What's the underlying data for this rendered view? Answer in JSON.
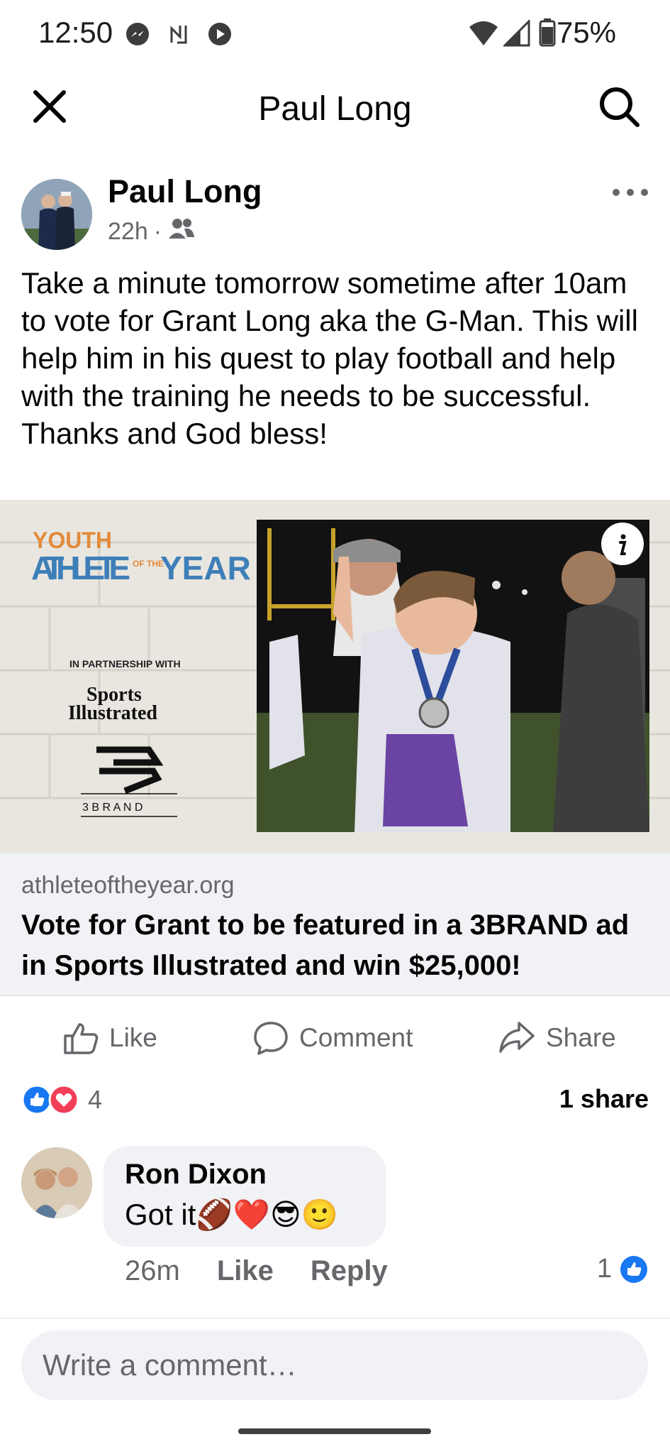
{
  "status_bar": {
    "time": "12:50",
    "battery": "75%",
    "icons": [
      "messenger-icon",
      "nfc-icon",
      "record-icon",
      "wifi-icon",
      "signal-icon",
      "battery-icon"
    ]
  },
  "header": {
    "title": "Paul Long"
  },
  "post": {
    "author": "Paul Long",
    "time": "22h",
    "separator": "·",
    "audience_icon": "friends-icon",
    "text": "Take a minute tomorrow sometime after 10am to vote for Grant Long aka the G-Man. This will help him in his quest to play football and help with the training he needs to be successful.\nThanks and God bless!"
  },
  "link": {
    "banner": {
      "youth": "YOUTH",
      "athlete": "ATHLETE",
      "of_the": "OF THE",
      "year": "YEAR",
      "partnership": "IN PARTNERSHIP WITH",
      "si_line1": "Sports",
      "si_line2": "Illustrated",
      "brand": "3 B R A N D"
    },
    "domain": "athleteoftheyear.org",
    "title": "Vote for Grant to be featured in a 3BRAND ad in Sports Illustrated and win $25,000!"
  },
  "actions": {
    "like": "Like",
    "comment": "Comment",
    "share": "Share"
  },
  "reactions": {
    "count": "4",
    "shares": "1 share"
  },
  "comment": {
    "author": "Ron Dixon",
    "text": "Got it",
    "emojis": "🏈❤️😎🙂",
    "time": "26m",
    "like": "Like",
    "reply": "Reply",
    "likes": "1"
  },
  "composer": {
    "placeholder": "Write a comment…"
  },
  "colors": {
    "facebook_blue": "#1877f2",
    "love_red": "#f33e58",
    "secondary_text": "#65676b"
  }
}
